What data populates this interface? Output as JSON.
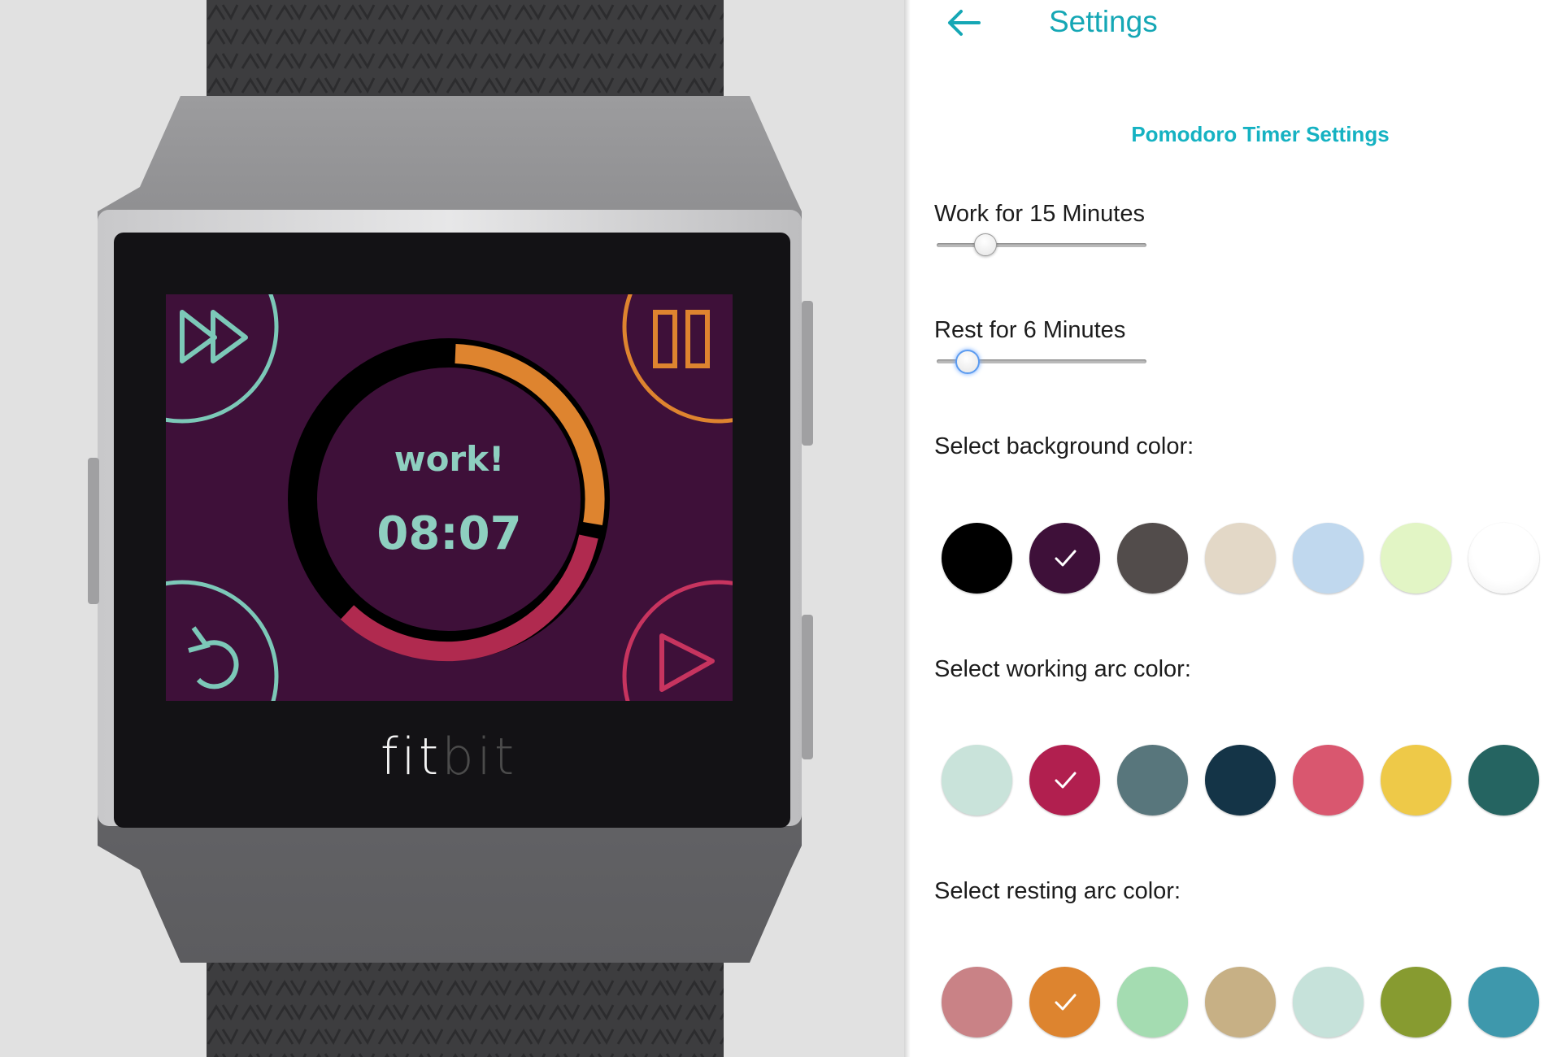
{
  "device": {
    "brand_part1": "fit",
    "brand_part2": "bit"
  },
  "watch_screen": {
    "status_label": "work!",
    "timer": "08:07",
    "background_color": "#3e1039",
    "work_arc_color": "#de842f",
    "rest_arc_color": "#b02a4f",
    "buttons": [
      {
        "name": "fast-forward-icon",
        "color": "#7cc8b8"
      },
      {
        "name": "pause-icon",
        "color": "#de842f"
      },
      {
        "name": "restart-icon",
        "color": "#7cc8b8"
      },
      {
        "name": "play-icon",
        "color": "#c7345f"
      }
    ]
  },
  "settings": {
    "title": "Settings",
    "section_title": "Pomodoro Timer Settings",
    "work_label": "Work for 15 Minutes",
    "work_slider_level": 0.2,
    "rest_label": "Rest for 6 Minutes",
    "rest_slider_level": 0.1,
    "background_label": "Select background color:",
    "working_arc_label": "Select working arc color:",
    "resting_arc_label": "Select resting arc color:",
    "background_colors": [
      "#000000",
      "#3e1039",
      "#524c4b",
      "#e3d8c7",
      "#c0d8ee",
      "#e2f5c5",
      "#ffffff"
    ],
    "background_selected": 1,
    "working_colors": [
      "#c9e3da",
      "#b11f4f",
      "#58767c",
      "#143447",
      "#d9576f",
      "#eec948",
      "#256461"
    ],
    "working_selected": 1,
    "resting_colors": [
      "#c98286",
      "#dd842f",
      "#a4dcb1",
      "#c7b085",
      "#c6e2da",
      "#879b30",
      "#3e98ac"
    ],
    "resting_selected": 1
  }
}
